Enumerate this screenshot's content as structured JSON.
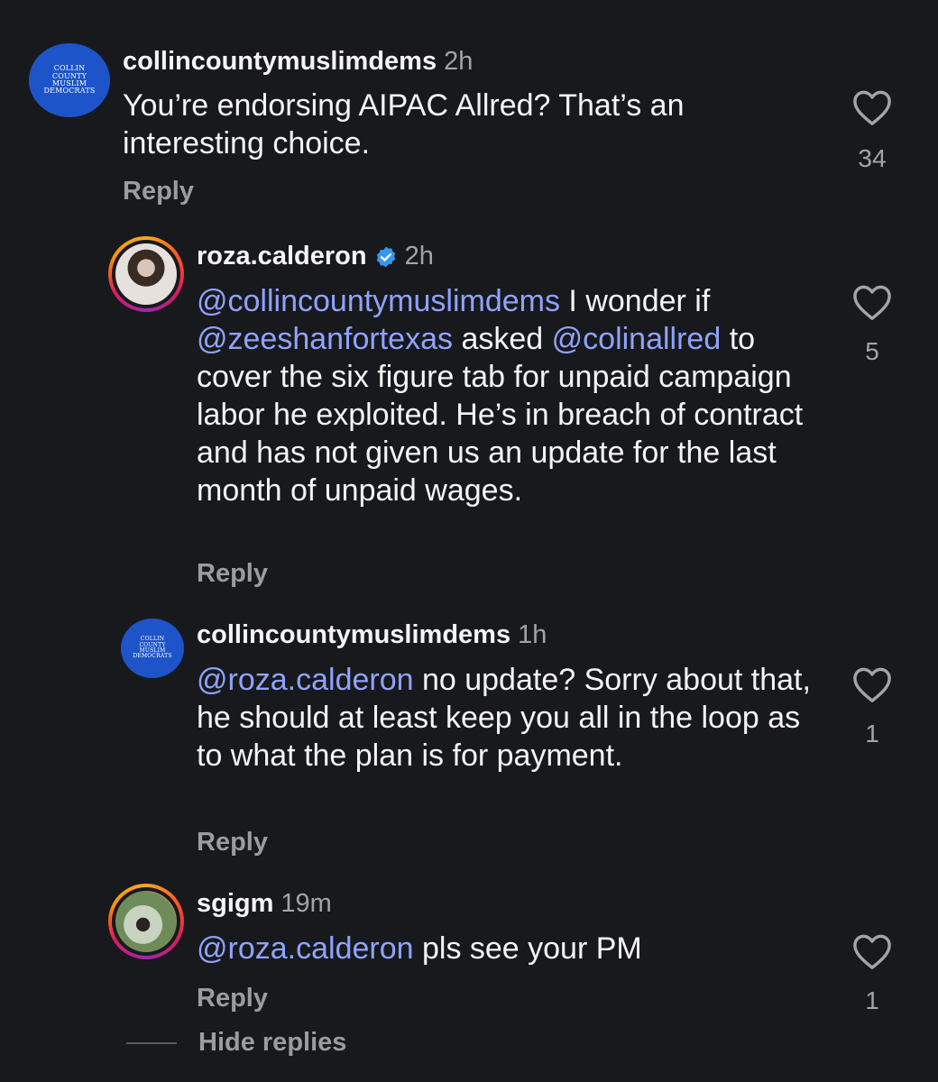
{
  "comments": [
    {
      "username": "collincountymuslimdems",
      "time": "2h",
      "text": "You’re endorsing AIPAC Allred? That’s an interesting choice.",
      "likes": "34",
      "reply_label": "Reply",
      "avatar_text": "COLLIN COUNTY MUSLIM DEMOCRATS"
    },
    {
      "username": "roza.calderon",
      "time": "2h",
      "verified": true,
      "segments": [
        "@collincountymuslimdems",
        " I wonder if ",
        "@zeeshanfortexas",
        " asked ",
        "@colinallred",
        " to cover the six figure tab for unpaid campaign labor he exploited. He’s in breach of contract and has not given us an update for the last month of unpaid wages."
      ],
      "likes": "5",
      "reply_label": "Reply"
    },
    {
      "username": "collincountymuslimdems",
      "time": "1h",
      "segments": [
        "@roza.calderon",
        " no update? Sorry about that, he should at least keep you all in the loop as to what the plan is for payment."
      ],
      "likes": "1",
      "reply_label": "Reply",
      "avatar_text": "COLLIN COUNTY MUSLIM DEMOCRATS"
    },
    {
      "username": "sgigm",
      "time": "19m",
      "segments": [
        "@roza.calderon",
        " pls see your PM"
      ],
      "likes": "1",
      "reply_label": "Reply"
    }
  ],
  "hide_replies_label": "Hide replies",
  "colors": {
    "background": "#18191c",
    "mention": "#8fa3ff",
    "verified": "#3897f0",
    "avatar_blue": "#1d54c9"
  }
}
